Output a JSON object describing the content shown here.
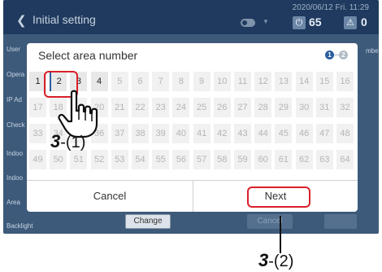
{
  "header": {
    "back_icon": "chevron-left-icon",
    "title": "Initial setting",
    "datetime": "2020/06/12 Fri. 11:29",
    "power_count": "65",
    "alert_count": "0"
  },
  "background": {
    "left_labels": [
      "User",
      "Opera",
      "IP Ad",
      "Check",
      "Indoo",
      "Indoo",
      "Area",
      "Backlight"
    ],
    "right_label": "mber",
    "change_label": "Change",
    "cancel_label": "Cancel"
  },
  "dialog": {
    "title": "Select area number",
    "steps": [
      "1",
      "2"
    ],
    "cancel_label": "Cancel",
    "next_label": "Next",
    "selected": 2,
    "enabled_max": 4,
    "numbers": [
      [
        1,
        2,
        3,
        4,
        5,
        6,
        7,
        8,
        9,
        10,
        11,
        12,
        13,
        14,
        15,
        16
      ],
      [
        17,
        18,
        19,
        20,
        21,
        22,
        23,
        24,
        25,
        26,
        27,
        28,
        29,
        30,
        31,
        32
      ],
      [
        33,
        34,
        35,
        36,
        37,
        38,
        39,
        40,
        41,
        42,
        43,
        44,
        45,
        46,
        47,
        48
      ],
      [
        49,
        50,
        51,
        52,
        53,
        54,
        55,
        56,
        57,
        58,
        59,
        60,
        61,
        62,
        63,
        64
      ]
    ]
  },
  "annotations": {
    "step1_num": "3",
    "step1_suffix": "-(1)",
    "step2_num": "3",
    "step2_suffix": "-(2)"
  },
  "colors": {
    "accent_red": "#d9202a",
    "selected_blue": "#2a5d9f"
  }
}
